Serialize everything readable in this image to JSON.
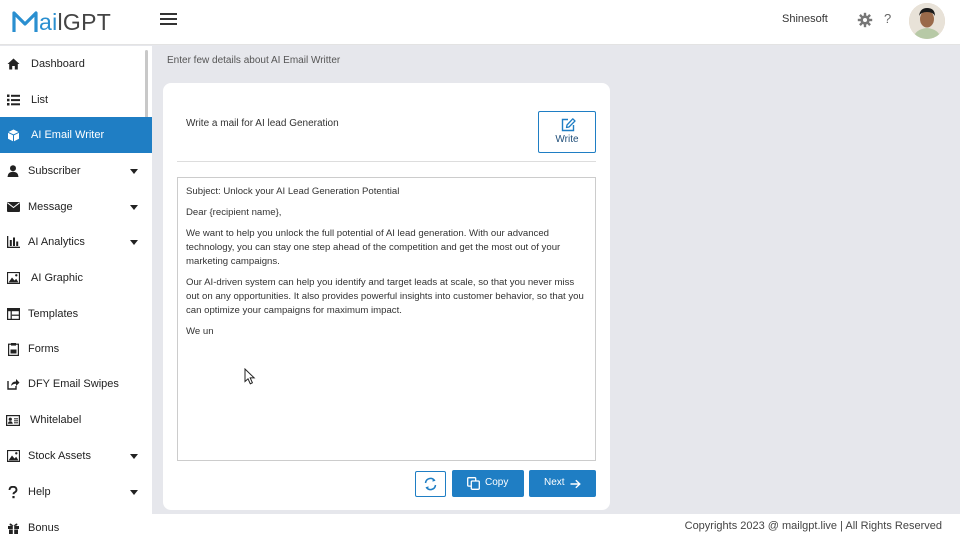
{
  "app": {
    "logo_prefix": "M",
    "logo_ai": "ai",
    "logo_suffix": "lGPT",
    "user_name": "Shinesoft",
    "help_glyph": "?",
    "accent_color": "#1f7ec4"
  },
  "icons": {
    "menu": "hamburger-icon",
    "settings": "gear-icon",
    "help": "question-icon",
    "write": "edit-icon",
    "refresh": "refresh-icon",
    "copy": "copy-icon",
    "next": "arrow-right-icon"
  },
  "sidebar": {
    "items": [
      {
        "label": "Dashboard",
        "icon": "home-icon",
        "caret": false,
        "active": false
      },
      {
        "label": "List",
        "icon": "list-icon",
        "caret": false,
        "active": false
      },
      {
        "label": "AI Email Writer",
        "icon": "cube-icon",
        "caret": false,
        "active": true
      },
      {
        "label": "Subscriber",
        "icon": "user-icon",
        "caret": true,
        "active": false
      },
      {
        "label": "Message",
        "icon": "envelope-icon",
        "caret": true,
        "active": false
      },
      {
        "label": "AI Analytics",
        "icon": "bar-chart-icon",
        "caret": true,
        "active": false
      },
      {
        "label": "AI Graphic",
        "icon": "image-icon",
        "caret": false,
        "active": false
      },
      {
        "label": "Templates",
        "icon": "template-icon",
        "caret": false,
        "active": false
      },
      {
        "label": "Forms",
        "icon": "form-icon",
        "caret": false,
        "active": false
      },
      {
        "label": "DFY Email Swipes",
        "icon": "share-icon",
        "caret": false,
        "active": false
      },
      {
        "label": "Whitelabel",
        "icon": "id-card-icon",
        "caret": false,
        "active": false
      },
      {
        "label": "Stock Assets",
        "icon": "image-icon",
        "caret": true,
        "active": false
      },
      {
        "label": "Help",
        "icon": "question-icon",
        "caret": true,
        "active": false
      },
      {
        "label": "Bonus",
        "icon": "gift-icon",
        "caret": false,
        "active": false
      }
    ]
  },
  "main": {
    "breadcrumb": "Enter few details about AI Email Writter",
    "prompt": "Write a mail for AI lead Generation",
    "write_label": "Write",
    "email_paragraphs": [
      "Subject: Unlock your AI Lead Generation Potential",
      "Dear {recipient name},",
      "We want to help you unlock the full potential of AI lead generation. With our advanced technology, you can stay one step ahead of the competition and get the most out of your marketing campaigns.",
      "Our AI-driven system can help you identify and target leads at scale, so that you never miss out on any opportunities. It also provides powerful insights into customer behavior, so that you can optimize your campaigns for maximum impact.",
      "We un"
    ],
    "copy_label": "Copy",
    "next_label": "Next"
  },
  "footer": {
    "text": "Copyrights 2023 @  mailgpt.live | All Rights Reserved"
  }
}
